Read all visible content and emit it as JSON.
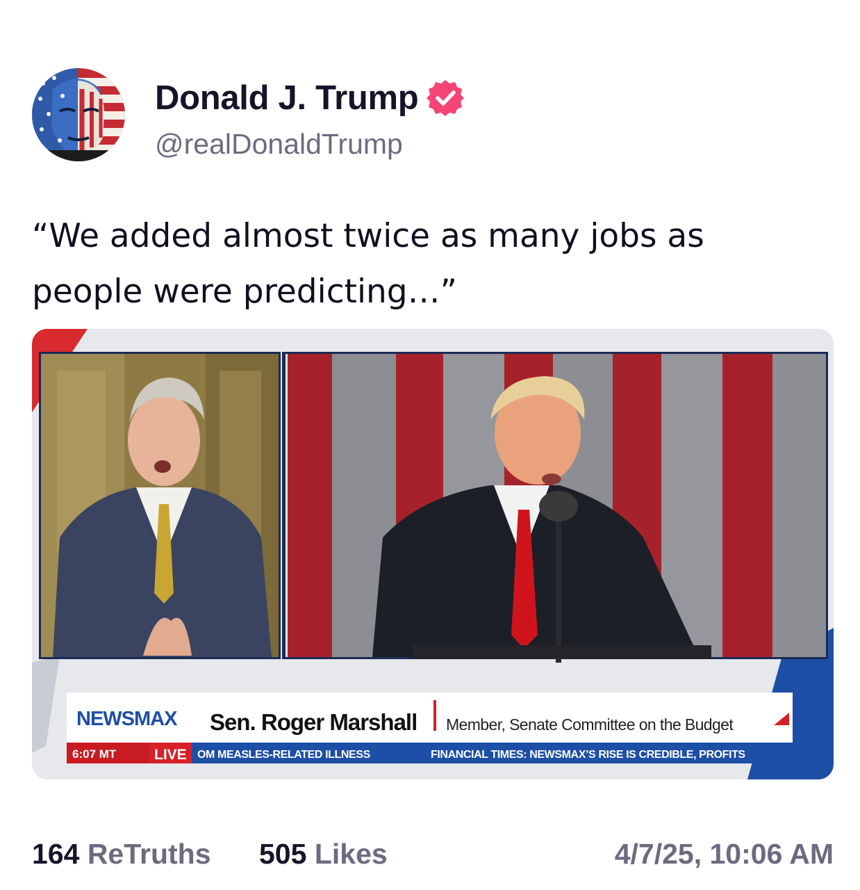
{
  "author": {
    "name": "Donald J. Trump",
    "handle": "@realDonaldTrump",
    "verified_color": "#f54476"
  },
  "post": {
    "text_line1": "“We added almost twice as many jobs as",
    "text_line2": "people were predicting…”"
  },
  "video": {
    "network": "NEWSMAX",
    "guest_name": "Sen. Roger Marshall",
    "guest_title": "Member, Senate Committee on the Budget",
    "time": "6:07 MT",
    "live": "LIVE",
    "ticker_left": "OM MEASLES-RELATED ILLNESS",
    "ticker_right": "FINANCIAL TIMES: NEWSMAX’S RISE IS CREDIBLE, PROFITS"
  },
  "stats": {
    "retruths_count": "164",
    "retruths_label": "ReTruths",
    "likes_count": "505",
    "likes_label": "Likes",
    "timestamp": "4/7/25, 10:06 AM"
  }
}
